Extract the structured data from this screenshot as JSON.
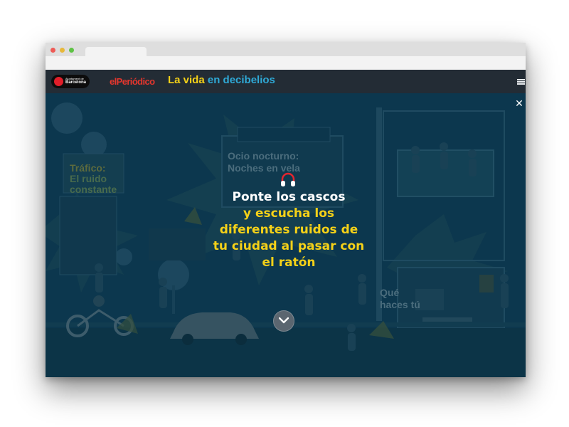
{
  "site": {
    "sponsor_line1": "Ajuntament de",
    "sponsor_city": "Barcelona",
    "publisher": "elPeriódico",
    "title_part1": "La vida",
    "title_part2": "en decibelios"
  },
  "scene_labels": {
    "ocio_line1": "Ocio nocturno:",
    "ocio_line2": "Noches en vela",
    "trafico_line1": "Tráfico:",
    "trafico_line2": "El ruido",
    "trafico_line3": "constante",
    "que_line1": "Qué",
    "que_line2": "haces tú"
  },
  "modal": {
    "line1": "Ponte los cascos",
    "line2": "y escucha los",
    "line3": "diferentes ruidos de",
    "line4": "tu ciudad al pasar con",
    "line5": "el ratón",
    "close_symbol": "✕"
  },
  "colors": {
    "scene_bg": "#0f3b53",
    "accent_yellow": "#f5d118",
    "accent_cyan": "#2fa9d6",
    "brand_red": "#e4362d",
    "header_bg": "#232c35"
  },
  "icons": [
    "headphones-icon",
    "close-icon",
    "chevron-down-icon",
    "hamburger-menu-icon"
  ]
}
